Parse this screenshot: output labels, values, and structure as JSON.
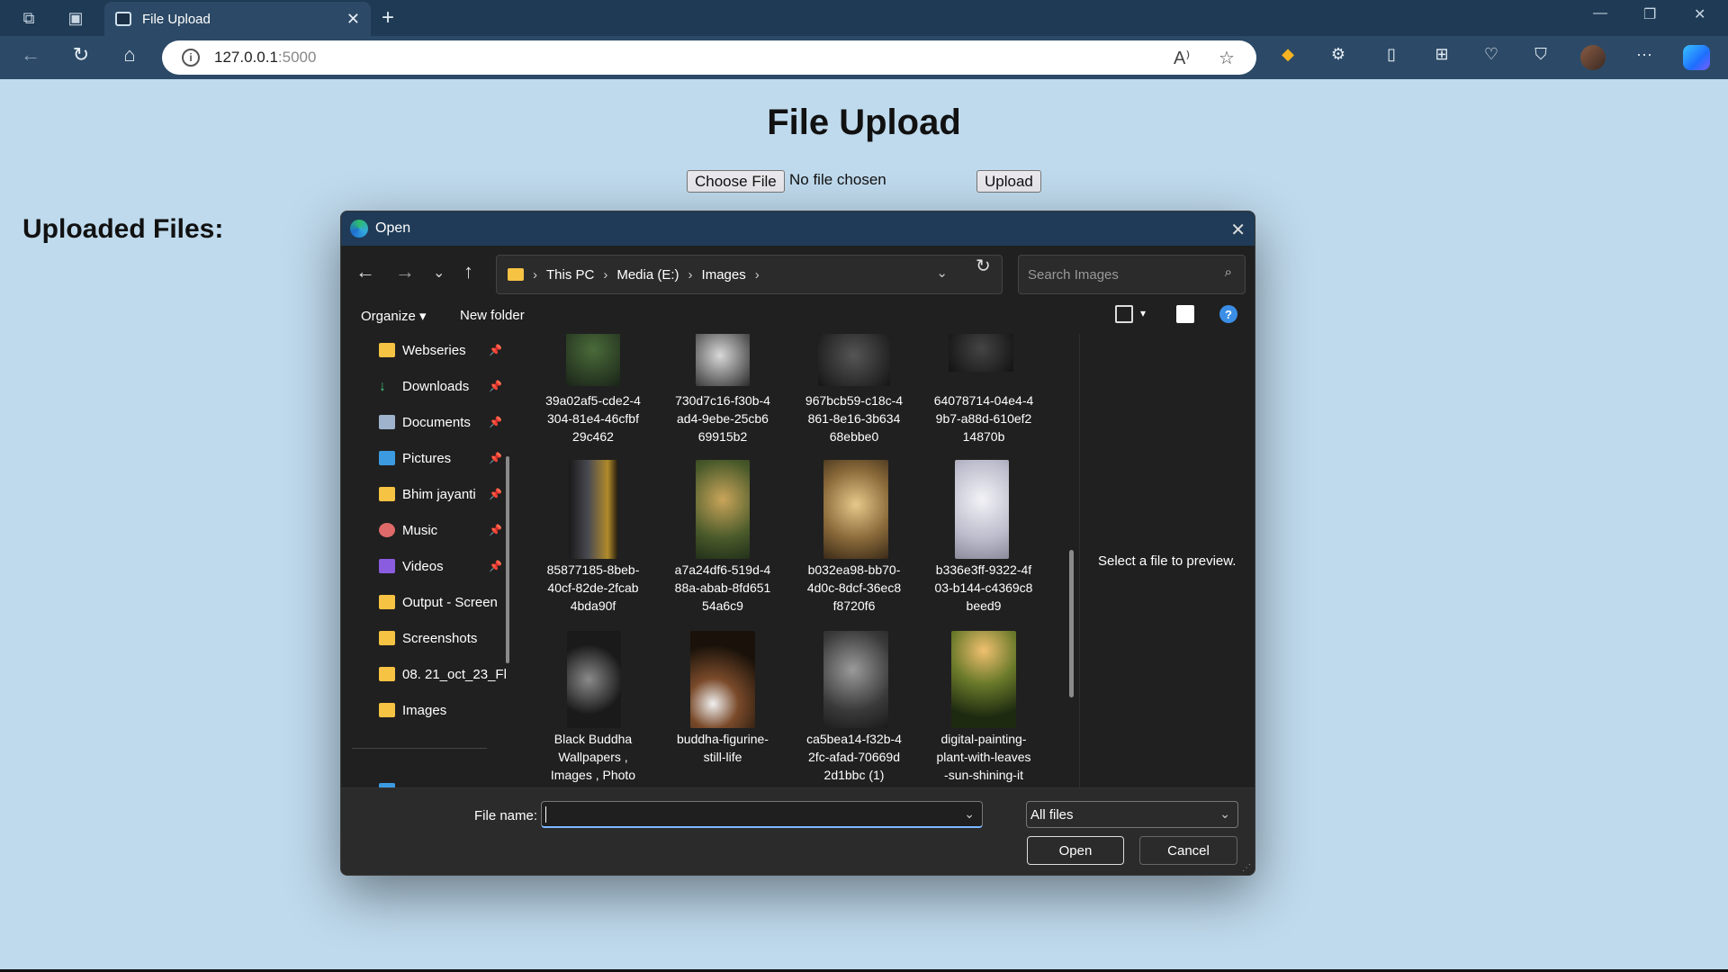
{
  "browser": {
    "tab_title": "File Upload",
    "url_host": "127.0.0.1",
    "url_port": ":5000",
    "new_tab": "+",
    "tab_close": "✕"
  },
  "page": {
    "title": "File Upload",
    "choose_file_label": "Choose File",
    "no_file_text": "No file chosen",
    "upload_label": "Upload",
    "uploaded_heading": "Uploaded Files:"
  },
  "dialog": {
    "title": "Open",
    "breadcrumb": [
      "This PC",
      "Media (E:)",
      "Images"
    ],
    "search_placeholder": "Search Images",
    "organize_label": "Organize",
    "new_folder_label": "New folder",
    "help_label": "?",
    "preview_text": "Select a file to preview.",
    "file_name_label": "File name:",
    "file_name_value": "",
    "file_type": "All files",
    "open_label": "Open",
    "cancel_label": "Cancel",
    "sidebar": [
      {
        "label": "Webseries",
        "icon": "folder-icon",
        "pinned": true
      },
      {
        "label": "Downloads",
        "icon": "download-icon",
        "pinned": true
      },
      {
        "label": "Documents",
        "icon": "documents-icon",
        "pinned": true
      },
      {
        "label": "Pictures",
        "icon": "pictures-icon",
        "pinned": true
      },
      {
        "label": "Bhim jayanti",
        "icon": "folder-icon",
        "pinned": true
      },
      {
        "label": "Music",
        "icon": "music-icon",
        "pinned": true
      },
      {
        "label": "Videos",
        "icon": "videos-icon",
        "pinned": true
      },
      {
        "label": "Output - Screen",
        "icon": "folder-icon",
        "pinned": false
      },
      {
        "label": "Screenshots",
        "icon": "folder-icon",
        "pinned": false
      },
      {
        "label": "08. 21_oct_23_Fl",
        "icon": "folder-icon",
        "pinned": false
      },
      {
        "label": "Images",
        "icon": "folder-icon",
        "pinned": false
      }
    ],
    "files": [
      {
        "name": "39a02af5-cde2-4\n304-81e4-46cfbf\n29c462",
        "color": "#2e3d2a"
      },
      {
        "name": "730d7c16-f30b-4\nad4-9ebe-25cb6\n69915b2",
        "color": "#9a9a9a"
      },
      {
        "name": "967bcb59-c18c-4\n861-8e16-3b634\n68ebbe0",
        "color": "#3a3a3a"
      },
      {
        "name": "64078714-04e4-4\n9b7-a88d-610ef2\n14870b",
        "color": "#2a2a2a"
      },
      {
        "name": "85877185-8beb-\n40cf-82de-2fcab\n4bda90f",
        "color": "#6a5620"
      },
      {
        "name": "a7a24df6-519d-4\n88a-abab-8fd651\n54a6c9",
        "color": "#5a6a34"
      },
      {
        "name": "b032ea98-bb70-\n4d0c-8dcf-36ec8\nf8720f6",
        "color": "#7a6a40"
      },
      {
        "name": "b336e3ff-9322-4f\n03-b144-c4369c8\nbeed9",
        "color": "#d8d8e6"
      },
      {
        "name": "Black Buddha\nWallpapers ,\nImages , Photo",
        "color": "#2a2a2a"
      },
      {
        "name": "buddha-figurine-\nstill-life",
        "color": "#3a2a1a"
      },
      {
        "name": "ca5bea14-f32b-4\n2fc-afad-70669d\n2d1bbc (1)",
        "color": "#4a4a4a"
      },
      {
        "name": "digital-painting-\nplant-with-leaves\n-sun-shining-it",
        "color": "#5a5a22"
      }
    ]
  }
}
